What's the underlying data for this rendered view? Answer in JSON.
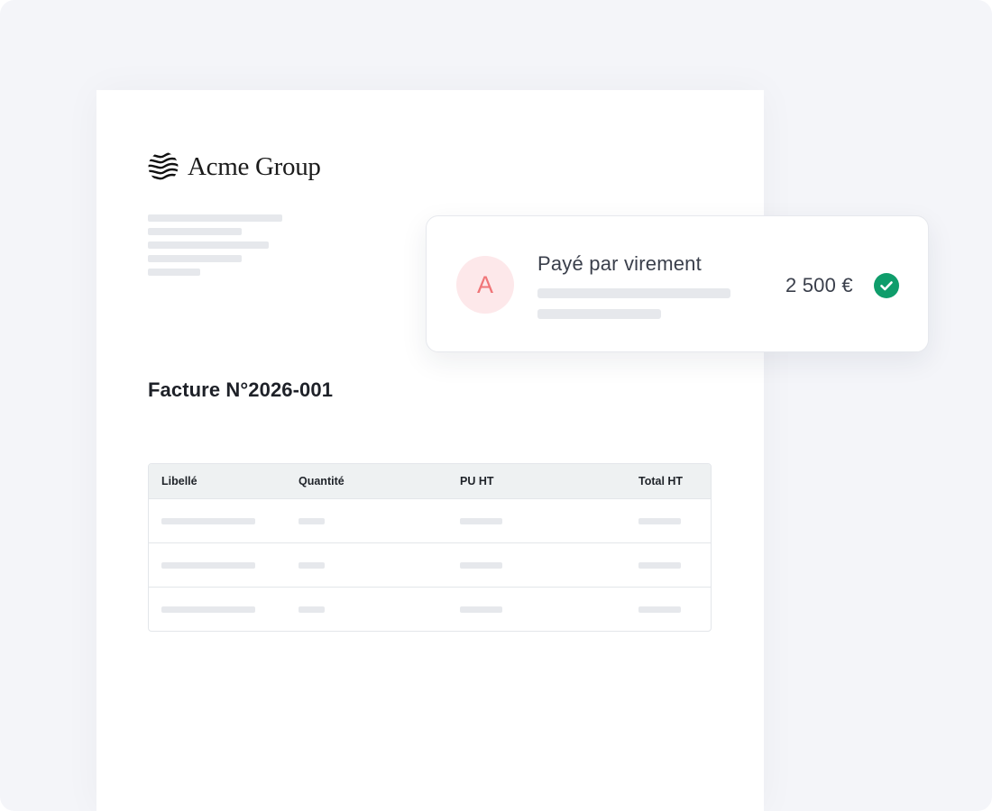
{
  "brand": {
    "name": "Acme Group",
    "logo_icon": "wave-stripes-icon"
  },
  "invoice": {
    "title": "Facture N°2026-001",
    "table": {
      "headers": [
        "Libellé",
        "Quantité",
        "PU HT",
        "Total HT"
      ],
      "rows": 3
    }
  },
  "payment": {
    "avatar_letter": "A",
    "label": "Payé par virement",
    "amount": "2 500 €",
    "status_icon": "check-circle-icon"
  },
  "colors": {
    "background": "#f4f5f9",
    "success": "#0f9d6b",
    "avatar_bg": "#fde8ea",
    "avatar_text": "#f07578"
  }
}
